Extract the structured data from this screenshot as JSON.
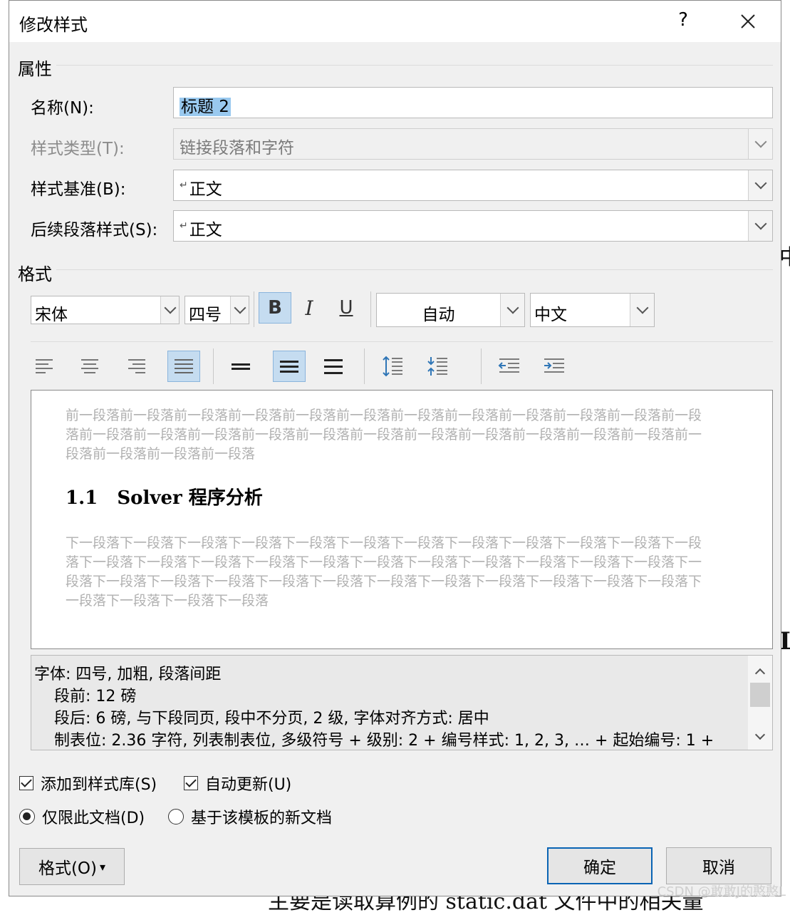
{
  "dialog": {
    "title": "修改样式",
    "help": "?",
    "close": "✕"
  },
  "properties": {
    "section": "属性",
    "name_label": "名称(N):",
    "name_value": "标题 2",
    "type_label": "样式类型(T):",
    "type_value": "链接段落和字符",
    "based_label": "样式基准(B):",
    "based_value": "正文",
    "next_label": "后续段落样式(S):",
    "next_value": "正文",
    "para_mark": "↵"
  },
  "format": {
    "section": "格式",
    "font": "宋体",
    "size": "四号",
    "bold": "B",
    "italic": "I",
    "underline": "U",
    "color": "自动",
    "script": "中文"
  },
  "preview": {
    "prev": "前一段落前一段落前一段落前一段落前一段落前一段落前一段落前一段落前一段落前一段落前一段落前一段落前一段落前一段落前一段落前一段落前一段落前一段落前一段落前一段落前一段落前一段落前一段落前一段落前一段落前一段落前一段落",
    "heading": "1.1   Solver 程序分析",
    "next": "下一段落下一段落下一段落下一段落下一段落下一段落下一段落下一段落下一段落下一段落下一段落下一段落下一段落下一段落下一段落下一段落下一段落下一段落下一段落下一段落下一段落下一段落下一段落下一段落下一段落下一段落下一段落下一段落下一段落下一段落下一段落下一段落下一段落下一段落下一段落下一段落下一段落下一段落下一段落"
  },
  "description": {
    "line1": "字体: 四号, 加粗, 段落间距",
    "line2": "段前: 12 磅",
    "line3": "段后: 6 磅, 与下段同页, 段中不分页, 2 级, 字体对齐方式: 居中",
    "line4": "制表位:  2.36 字符, 列表制表位, 多级符号 + 级别: 2 + 编号样式: 1, 2, 3, … + 起始编号: 1 +"
  },
  "options": {
    "add_to_gallery": "添加到样式库(S)",
    "auto_update": "自动更新(U)",
    "only_this_doc": "仅限此文档(D)",
    "new_docs": "基于该模板的新文档"
  },
  "buttons": {
    "format": "格式(O)",
    "format_arrow": "▾",
    "ok": "确定",
    "cancel": "取消"
  },
  "background": {
    "frag_bottom": "主要是读取算例的 static.dat 文件中的相关量",
    "watermark": "CSDN @敢敢J的憨憨L"
  },
  "colors": {
    "selection": "#99c9ef",
    "active_button": "#c5dcf0",
    "default_border": "#0a64b4"
  }
}
